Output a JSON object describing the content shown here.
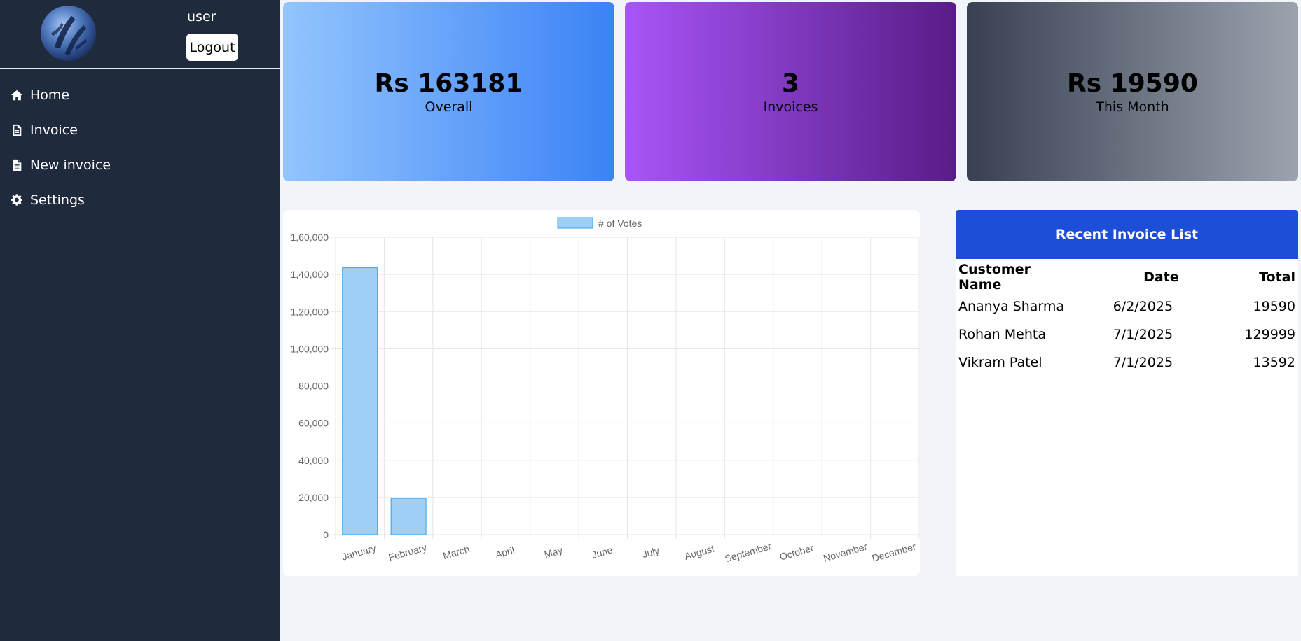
{
  "user": {
    "name": "user",
    "logout_label": "Logout"
  },
  "sidebar": {
    "items": [
      {
        "label": "Home",
        "icon": "home-icon"
      },
      {
        "label": "Invoice",
        "icon": "file-icon"
      },
      {
        "label": "New invoice",
        "icon": "file-text-icon"
      },
      {
        "label": "Settings",
        "icon": "gear-icon"
      }
    ]
  },
  "stats": [
    {
      "value": "Rs 163181",
      "label": "Overall"
    },
    {
      "value": "3",
      "label": "Invoices"
    },
    {
      "value": "Rs 19590",
      "label": "This Month"
    }
  ],
  "chart_data": {
    "type": "bar",
    "categories": [
      "January",
      "February",
      "March",
      "April",
      "May",
      "June",
      "July",
      "August",
      "September",
      "October",
      "November",
      "December"
    ],
    "series": [
      {
        "name": "# of Votes",
        "values": [
          143591,
          19590,
          0,
          0,
          0,
          0,
          0,
          0,
          0,
          0,
          0,
          0
        ]
      }
    ],
    "yticks": [
      "0",
      "20,000",
      "40,000",
      "60,000",
      "80,000",
      "1,00,000",
      "1,20,000",
      "1,40,000",
      "1,60,000"
    ],
    "ylim": [
      0,
      160000
    ],
    "legend": "top",
    "grid": true,
    "colors": {
      "bar_fill": "#9ecff5",
      "bar_stroke": "#36a2eb",
      "grid": "#e5e5e5",
      "text": "#666666"
    }
  },
  "recent_invoices": {
    "title": "Recent Invoice List",
    "headers": {
      "name": "Customer Name",
      "date": "Date",
      "total": "Total"
    },
    "rows": [
      {
        "name": "Ananya Sharma",
        "date": "6/2/2025",
        "total": "19590"
      },
      {
        "name": "Rohan Mehta",
        "date": "7/1/2025",
        "total": "129999"
      },
      {
        "name": "Vikram Patel",
        "date": "7/1/2025",
        "total": "13592"
      }
    ]
  }
}
